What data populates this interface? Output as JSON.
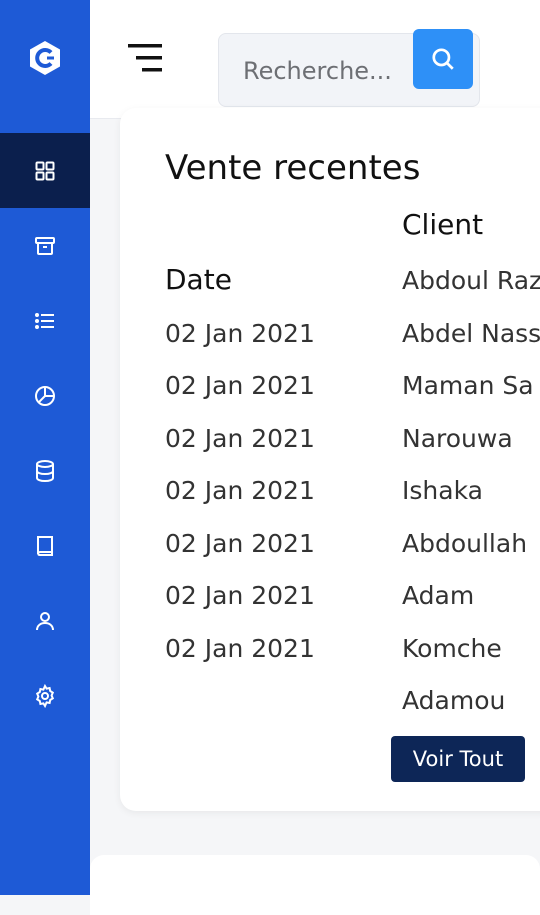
{
  "search": {
    "placeholder": "Recherche..."
  },
  "sales": {
    "title": "Vente recentes",
    "columns": {
      "date": "Date",
      "client": "Client"
    },
    "dates": [
      "02 Jan 2021",
      "02 Jan 2021",
      "02 Jan 2021",
      "02 Jan 2021",
      "02 Jan 2021",
      "02 Jan 2021",
      "02 Jan 2021"
    ],
    "clients": [
      "Abdoul Raz",
      "Abdel Nass",
      "Maman Sa",
      "Narouwa",
      "Ishaka",
      "Abdoullah",
      "Adam",
      "Komche",
      "Adamou"
    ],
    "view_all_label": "Voir Tout"
  },
  "sidebar": {
    "items": [
      {
        "icon": "dashboard-grid-icon",
        "active": true
      },
      {
        "icon": "archive-box-icon",
        "active": false
      },
      {
        "icon": "list-icon",
        "active": false
      },
      {
        "icon": "pie-chart-icon",
        "active": false
      },
      {
        "icon": "database-icon",
        "active": false
      },
      {
        "icon": "book-icon",
        "active": false
      },
      {
        "icon": "user-icon",
        "active": false
      },
      {
        "icon": "settings-gear-icon",
        "active": false
      }
    ]
  },
  "colors": {
    "sidebar": "#1e5ad6",
    "sidebar_active": "#0b1f4d",
    "accent": "#2e90f7",
    "button_dark": "#0d2657"
  }
}
